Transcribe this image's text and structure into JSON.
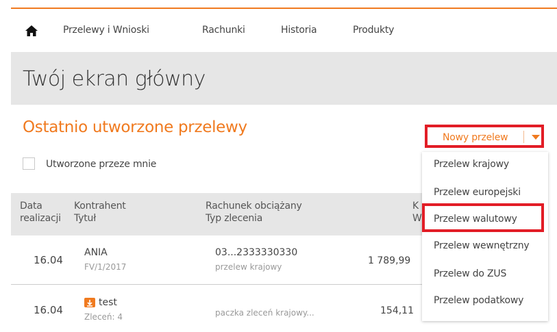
{
  "nav": {
    "home_icon": "home-icon",
    "items": [
      "Przelewy i Wnioski",
      "Rachunki",
      "Historia",
      "Produkty"
    ]
  },
  "header": {
    "title": "Twój ekran główny"
  },
  "section": {
    "title": "Ostatnio utworzone przelewy",
    "filter_label": "Utworzone przeze mnie"
  },
  "table": {
    "headers": {
      "date_1": "Data",
      "date_2": "realizacji",
      "party_1": "Kontrahent",
      "party_2": "Tytuł",
      "account_1": "Rachunek obciążany",
      "account_2": "Typ zlecenia",
      "amount_1": "K",
      "amount_2": "W"
    },
    "rows": [
      {
        "date": "16.04",
        "party": "ANIA",
        "title": "FV/1/2017",
        "account": "03...2333330330",
        "type": "przelew krajowy",
        "amount": "1 789,99"
      },
      {
        "date": "16.04",
        "party": "test",
        "title": "Zleceń: 4",
        "account": "",
        "type": "paczka zleceń krajowy...",
        "amount": "154,11"
      }
    ]
  },
  "dropdown": {
    "button_label": "Nowy przelew",
    "options": [
      "Przelew krajowy",
      "Przelew europejski",
      "Przelew walutowy",
      "Przelew wewnętrzny",
      "Przelew do ZUS",
      "Przelew podatkowy"
    ]
  },
  "colors": {
    "accent": "#f07a1f",
    "highlight": "#e21d26",
    "band": "#e6e6e6"
  }
}
